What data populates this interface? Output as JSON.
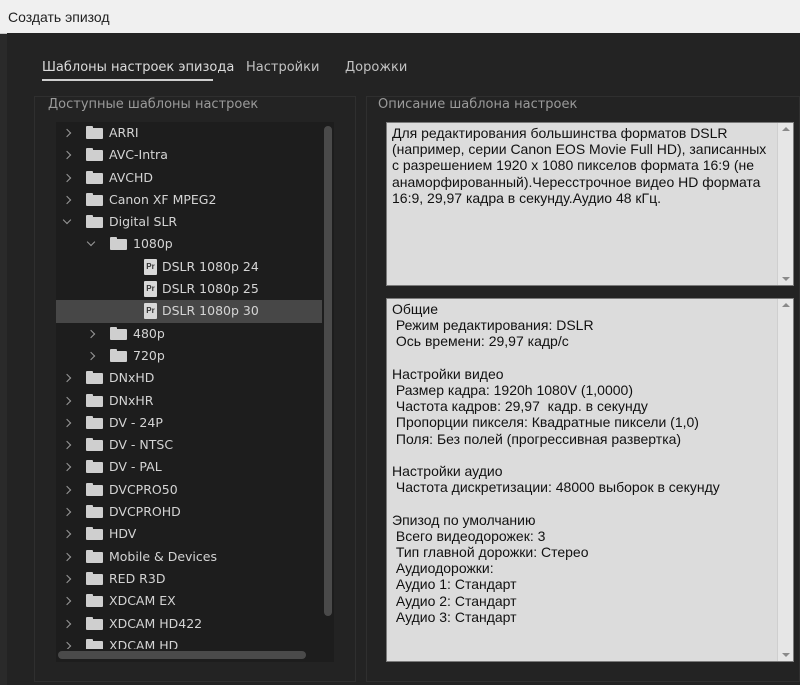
{
  "window": {
    "title": "Создать эпизод"
  },
  "tabs": [
    {
      "label": "Шаблоны настроек эпизода",
      "active": true
    },
    {
      "label": "Настройки",
      "active": false
    },
    {
      "label": "Дорожки",
      "active": false
    }
  ],
  "presets": {
    "label": "Доступные шаблоны настроек",
    "tree": [
      {
        "label": "ARRI",
        "type": "folder",
        "level": 0,
        "expanded": false
      },
      {
        "label": "AVC-Intra",
        "type": "folder",
        "level": 0,
        "expanded": false
      },
      {
        "label": "AVCHD",
        "type": "folder",
        "level": 0,
        "expanded": false
      },
      {
        "label": "Canon XF MPEG2",
        "type": "folder",
        "level": 0,
        "expanded": false
      },
      {
        "label": "Digital SLR",
        "type": "folder",
        "level": 0,
        "expanded": true
      },
      {
        "label": "1080p",
        "type": "folder",
        "level": 1,
        "expanded": true
      },
      {
        "label": "DSLR 1080p 24",
        "type": "preset",
        "level": 2
      },
      {
        "label": "DSLR 1080p 25",
        "type": "preset",
        "level": 2
      },
      {
        "label": "DSLR 1080p 30",
        "type": "preset",
        "level": 2,
        "selected": true
      },
      {
        "label": "480p",
        "type": "folder",
        "level": 1,
        "expanded": false
      },
      {
        "label": "720p",
        "type": "folder",
        "level": 1,
        "expanded": false
      },
      {
        "label": "DNxHD",
        "type": "folder",
        "level": 0,
        "expanded": false
      },
      {
        "label": "DNxHR",
        "type": "folder",
        "level": 0,
        "expanded": false
      },
      {
        "label": "DV - 24P",
        "type": "folder",
        "level": 0,
        "expanded": false
      },
      {
        "label": "DV - NTSC",
        "type": "folder",
        "level": 0,
        "expanded": false
      },
      {
        "label": "DV - PAL",
        "type": "folder",
        "level": 0,
        "expanded": false
      },
      {
        "label": "DVCPRO50",
        "type": "folder",
        "level": 0,
        "expanded": false
      },
      {
        "label": "DVCPROHD",
        "type": "folder",
        "level": 0,
        "expanded": false
      },
      {
        "label": "HDV",
        "type": "folder",
        "level": 0,
        "expanded": false
      },
      {
        "label": "Mobile & Devices",
        "type": "folder",
        "level": 0,
        "expanded": false
      },
      {
        "label": "RED R3D",
        "type": "folder",
        "level": 0,
        "expanded": false
      },
      {
        "label": "XDCAM EX",
        "type": "folder",
        "level": 0,
        "expanded": false
      },
      {
        "label": "XDCAM HD422",
        "type": "folder",
        "level": 0,
        "expanded": false
      },
      {
        "label": "XDCAM HD",
        "type": "folder",
        "level": 0,
        "expanded": false
      }
    ]
  },
  "description": {
    "label": "Описание шаблона настроек",
    "text": "Для редактирования большинства форматов DSLR (например, серии Canon EOS Movie Full HD), записанных с разрешением 1920 x 1080 пикселов формата 16:9 (не анаморфированный).Чересстрочное видео HD формата 16:9, 29,97 кадра в секунду.Аудио 48 кГц."
  },
  "details": {
    "text": "Общие\n Режим редактирования: DSLR\n Ось времени: 29,97 кадр/с\n\nНастройки видео\n Размер кадра: 1920h 1080V (1,0000)\n Частота кадров: 29,97  кадр. в секунду\n Пропорции пикселя: Квадратные пиксели (1,0)\n Поля: Без полей (прогрессивная развертка)\n\nНастройки аудио\n Частота дискретизации: 48000 выборок в секунду\n\nЭпизод по умолчанию\n Всего видеодорожек: 3\n Тип главной дорожки: Стерео\n Аудиодорожки:\n Аудио 1: Стандарт\n Аудио 2: Стандарт\n Аудио 3: Стандарт"
  }
}
